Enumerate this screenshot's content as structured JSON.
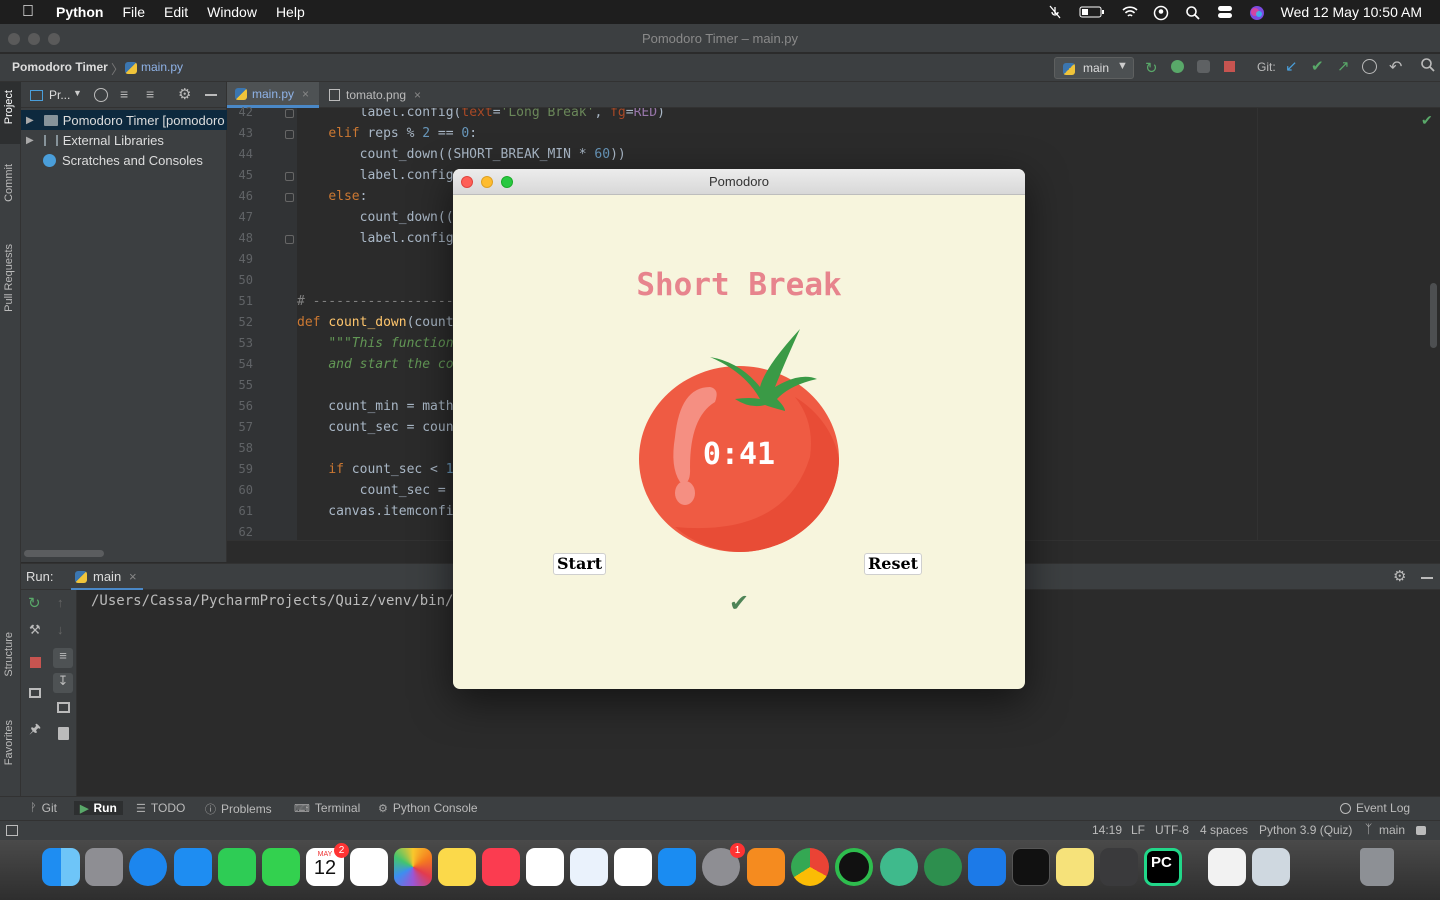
{
  "menubar": {
    "items": [
      "Python",
      "File",
      "Edit",
      "Window",
      "Help"
    ],
    "datetime": "Wed 12 May  10:50 AM"
  },
  "window": {
    "title": "Pomodoro Timer – main.py"
  },
  "nav": {
    "project": "Pomodoro Timer",
    "file": "main.py",
    "branch": "main",
    "git_label": "Git:"
  },
  "left_tools": [
    "Project",
    "Commit",
    "Pull Requests",
    "Structure",
    "Favorites"
  ],
  "project_panel": {
    "header": "Pr...",
    "items": [
      "Pomodoro Timer [pomodoro",
      "External Libraries",
      "Scratches and Consoles"
    ]
  },
  "tabs": [
    "main.py",
    "tomato.png"
  ],
  "code_lines": [
    {
      "n": "42",
      "html": "        label.config(<span class='par'>text</span>=<span class='str'>'Long Break'</span>, <span class='par'>fg</span>=<span class='pur'>RED</span>)"
    },
    {
      "n": "43",
      "html": "    <span class='kw'>elif</span> reps % <span class='num'>2</span> == <span class='num'>0</span>:"
    },
    {
      "n": "44",
      "html": "        count_down((SHORT_BREAK_MIN * <span class='num'>60</span>))"
    },
    {
      "n": "45",
      "html": "        label.config"
    },
    {
      "n": "46",
      "html": "    <span class='kw'>else</span>:"
    },
    {
      "n": "47",
      "html": "        count_down(("
    },
    {
      "n": "48",
      "html": "        label.config"
    },
    {
      "n": "49",
      "html": ""
    },
    {
      "n": "50",
      "html": ""
    },
    {
      "n": "51",
      "html": "<span class='cm'># -------------------</span>"
    },
    {
      "n": "52",
      "html": "<span class='kw'>def</span> <span class='fn'>count_down</span>(count"
    },
    {
      "n": "53",
      "html": "    <span class='doc'>\"\"\"This function</span>"
    },
    {
      "n": "54",
      "html": "    <span class='doc'>and start the co</span>"
    },
    {
      "n": "55",
      "html": ""
    },
    {
      "n": "56",
      "html": "    count_min = math"
    },
    {
      "n": "57",
      "html": "    count_sec = coun"
    },
    {
      "n": "58",
      "html": ""
    },
    {
      "n": "59",
      "html": "    <span class='kw'>if</span> count_sec &lt; <span class='num'>1</span>"
    },
    {
      "n": "60",
      "html": "        count_sec = "
    },
    {
      "n": "61",
      "html": "    canvas.itemconfi"
    },
    {
      "n": "62",
      "html": ""
    }
  ],
  "run": {
    "label": "Run:",
    "tab": "main",
    "output": "/Users/Cassa/PycharmProjects/Quiz/venv/bin/py"
  },
  "tool_tabs": [
    "Git",
    "Run",
    "TODO",
    "Problems",
    "Terminal",
    "Python Console"
  ],
  "event_log": "Event Log",
  "status": {
    "position": "14:19",
    "line_sep": "LF",
    "encoding": "UTF-8",
    "indent": "4 spaces",
    "interpreter": "Python 3.9 (Quiz)",
    "branch": "main"
  },
  "pomodoro": {
    "title": "Pomodoro",
    "heading": "Short Break",
    "timer": "0:41",
    "start": "Start",
    "reset": "Reset",
    "checks": "✔"
  },
  "dock": {
    "calendar_month": "MAY",
    "calendar_day": "12",
    "calendar_badge": "2",
    "settings_badge": "1",
    "pycharm_label": "PC"
  },
  "colors": {
    "heading_pink": "#e7848d",
    "bg_cream": "#f7f5dd",
    "tomato": "#ef5b43",
    "check_green": "#4e8456"
  }
}
